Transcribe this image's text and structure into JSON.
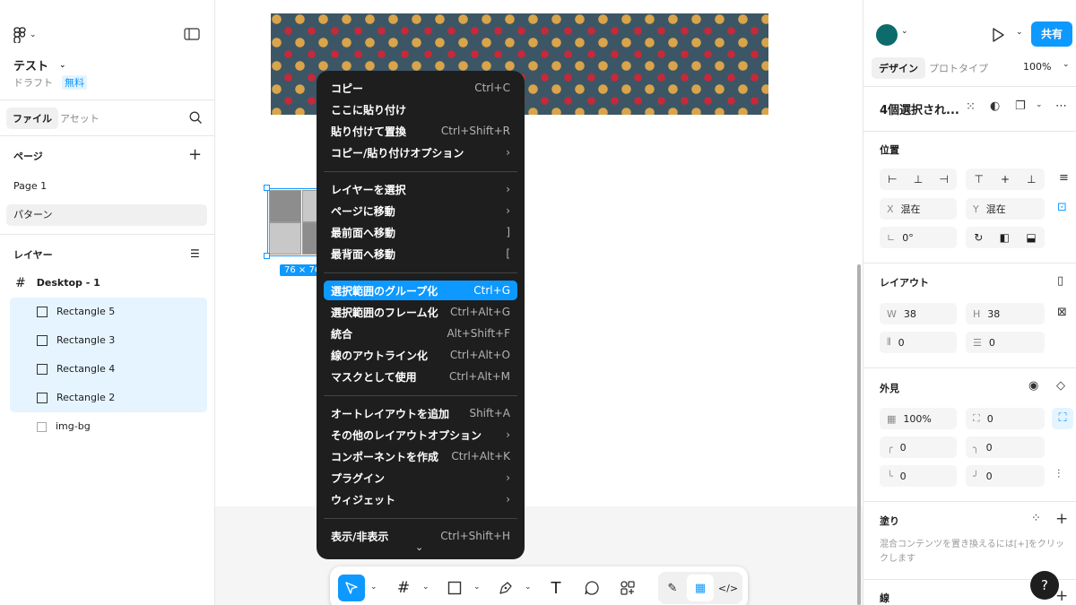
{
  "left": {
    "file_name": "テスト",
    "draft": "ドラフト",
    "plan": "無料",
    "tab_file": "ファイル",
    "tab_assets": "アセット",
    "pages_title": "ページ",
    "pages": [
      "Page 1",
      "パターン"
    ],
    "layers_title": "レイヤー",
    "frame": "Desktop - 1",
    "layers": [
      "Rectangle 5",
      "Rectangle 3",
      "Rectangle 4",
      "Rectangle 2",
      "img-bg"
    ]
  },
  "canvas": {
    "size_badge": "76 × 76"
  },
  "menu": {
    "items": [
      {
        "label": "コピー",
        "sc": "Ctrl+C"
      },
      {
        "label": "ここに貼り付け",
        "sc": ""
      },
      {
        "label": "貼り付けて置換",
        "sc": "Ctrl+Shift+R"
      },
      {
        "label": "コピー/貼り付けオプション",
        "sc": "›"
      },
      {
        "label": "レイヤーを選択",
        "sc": "›"
      },
      {
        "label": "ページに移動",
        "sc": "›"
      },
      {
        "label": "最前面へ移動",
        "sc": "]"
      },
      {
        "label": "最背面へ移動",
        "sc": "["
      },
      {
        "label": "選択範囲のグループ化",
        "sc": "Ctrl+G"
      },
      {
        "label": "選択範囲のフレーム化",
        "sc": "Ctrl+Alt+G"
      },
      {
        "label": "統合",
        "sc": "Alt+Shift+F"
      },
      {
        "label": "線のアウトライン化",
        "sc": "Ctrl+Alt+O"
      },
      {
        "label": "マスクとして使用",
        "sc": "Ctrl+Alt+M"
      },
      {
        "label": "オートレイアウトを追加",
        "sc": "Shift+A"
      },
      {
        "label": "その他のレイアウトオプション",
        "sc": "›"
      },
      {
        "label": "コンポーネントを作成",
        "sc": "Ctrl+Alt+K"
      },
      {
        "label": "プラグイン",
        "sc": "›"
      },
      {
        "label": "ウィジェット",
        "sc": "›"
      },
      {
        "label": "表示/非表示",
        "sc": "Ctrl+Shift+H"
      }
    ]
  },
  "right": {
    "share": "共有",
    "tab_design": "デザイン",
    "tab_prototype": "プロトタイプ",
    "zoom": "100%",
    "selection_title": "4個選択され...",
    "position_title": "位置",
    "x_label": "X",
    "x_value": "混在",
    "y_label": "Y",
    "y_value": "混在",
    "rotation": "0°",
    "layout_title": "レイアウト",
    "w_label": "W",
    "w_value": "38",
    "h_label": "H",
    "h_value": "38",
    "gap_h": "0",
    "gap_v": "0",
    "appearance_title": "外見",
    "opacity": "100%",
    "radius_all": "0",
    "r_tl": "0",
    "r_tr": "0",
    "r_bl": "0",
    "r_br": "0",
    "fill_title": "塗り",
    "fill_hint": "混合コンテンツを置き換えるには[+]をクリックします",
    "stroke_title": "線",
    "help": "?"
  },
  "colors": {
    "accent": "#0d99ff",
    "menu_bg": "#1e1e1e",
    "avatar": "#0e6b6b"
  }
}
